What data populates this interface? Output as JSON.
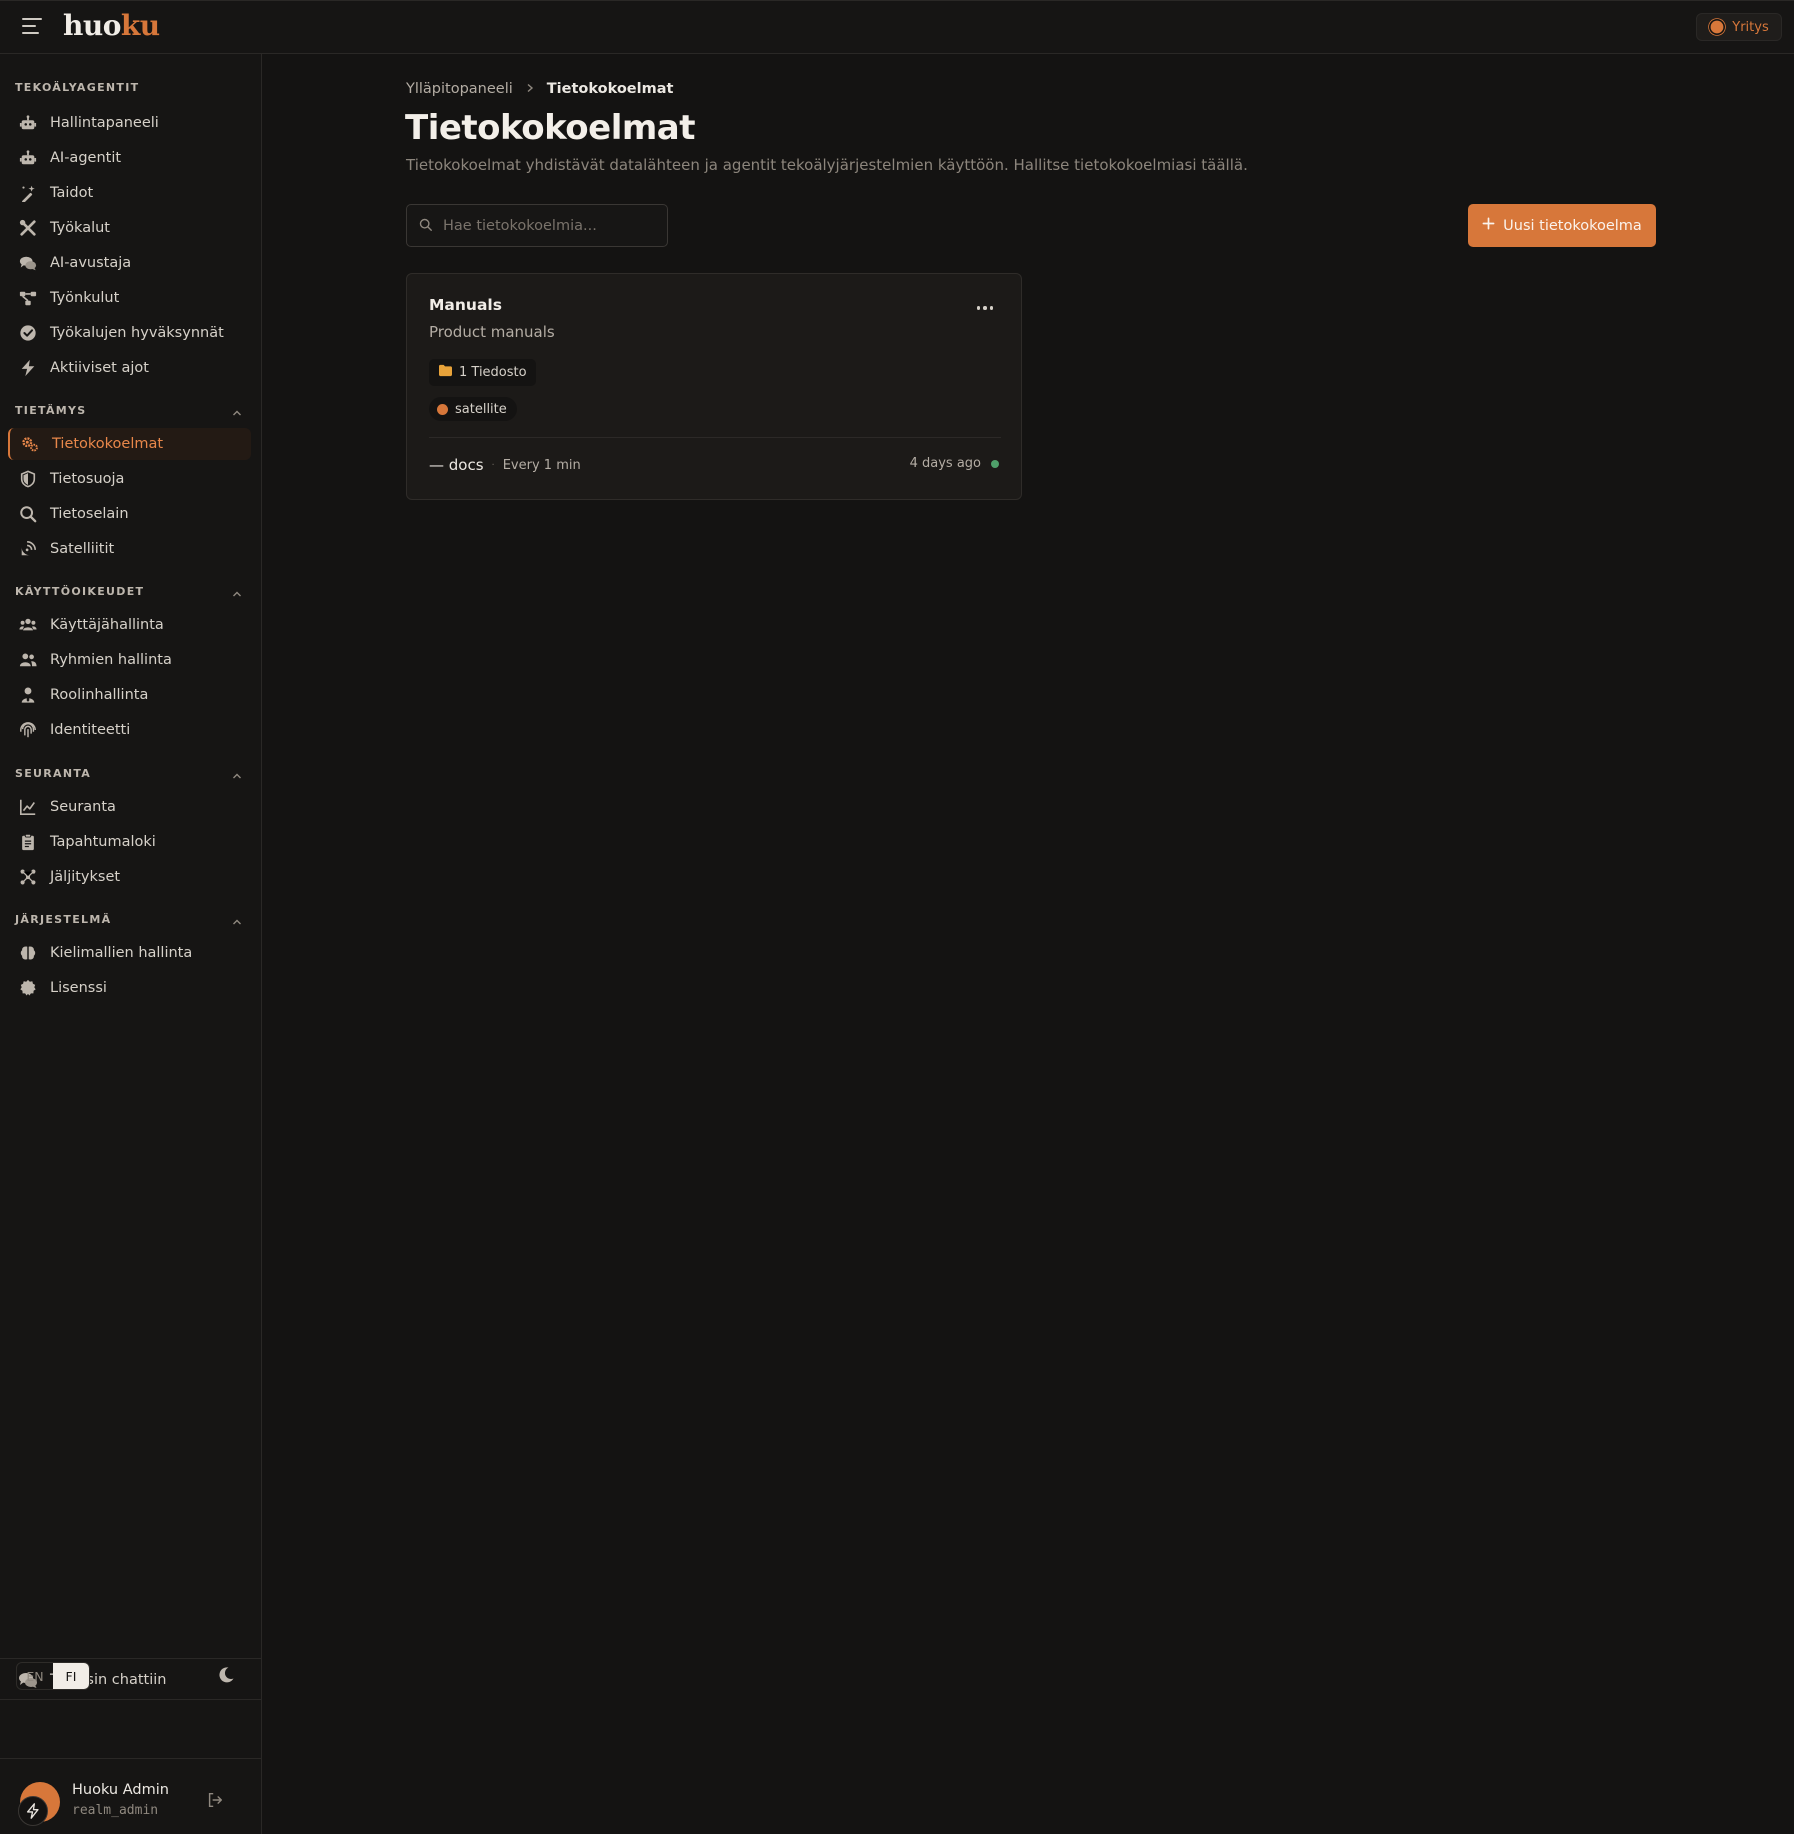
{
  "header": {
    "logo_part1": "huo",
    "logo_part2": "ku",
    "org_label": "Yritys"
  },
  "sidebar": {
    "sections": {
      "agents": "TEKOÄLYAGENTIT",
      "knowledge": "TIETÄMYS",
      "permissions": "KÄYTTÖOIKEUDET",
      "monitoring": "SEURANTA",
      "system": "JÄRJESTELMÄ"
    },
    "items": {
      "dashboard": "Hallintapaneeli",
      "ai_agents": "AI-agentit",
      "skills": "Taidot",
      "tools": "Työkalut",
      "ai_assistant": "AI-avustaja",
      "workflows": "Työnkulut",
      "tool_approvals": "Työkalujen hyväksynnät",
      "active_runs": "Aktiiviset ajot",
      "collections": "Tietokokoelmat",
      "data_protection": "Tietosuoja",
      "data_browser": "Tietoselain",
      "satellites": "Satelliitit",
      "user_mgmt": "Käyttäjähallinta",
      "group_mgmt": "Ryhmien hallinta",
      "role_mgmt": "Roolinhallinta",
      "identity": "Identiteetti",
      "monitoring": "Seuranta",
      "event_log": "Tapahtumaloki",
      "traces": "Jäljitykset",
      "model_mgmt": "Kielimallien hallinta",
      "license": "Lisenssi"
    },
    "back_to_chat": "Takaisin chattiin",
    "lang_en": "EN",
    "lang_fi": "FI",
    "user_name": "Huoku Admin",
    "user_role": "realm_admin"
  },
  "main": {
    "breadcrumb_parent": "Ylläpitopaneeli",
    "breadcrumb_current": "Tietokokoelmat",
    "title": "Tietokokoelmat",
    "description": "Tietokokoelmat yhdistävät datalähteen ja agentit tekoälyjärjestelmien käyttöön. Hallitse tietokokoelmiasi täällä.",
    "search_placeholder": "Hae tietokokoelmia...",
    "new_button": "Uusi tietokokoelma",
    "card": {
      "title": "Manuals",
      "subtitle": "Product manuals",
      "files_chip": "1 Tiedosto",
      "satellite_chip": "satellite",
      "source_name": "— docs",
      "separator": "·",
      "frequency": "Every 1 min",
      "last_sync": "4 days ago"
    }
  },
  "colors": {
    "accent": "#d7773a",
    "background": "#141312",
    "status_ok": "#4fa06a"
  }
}
